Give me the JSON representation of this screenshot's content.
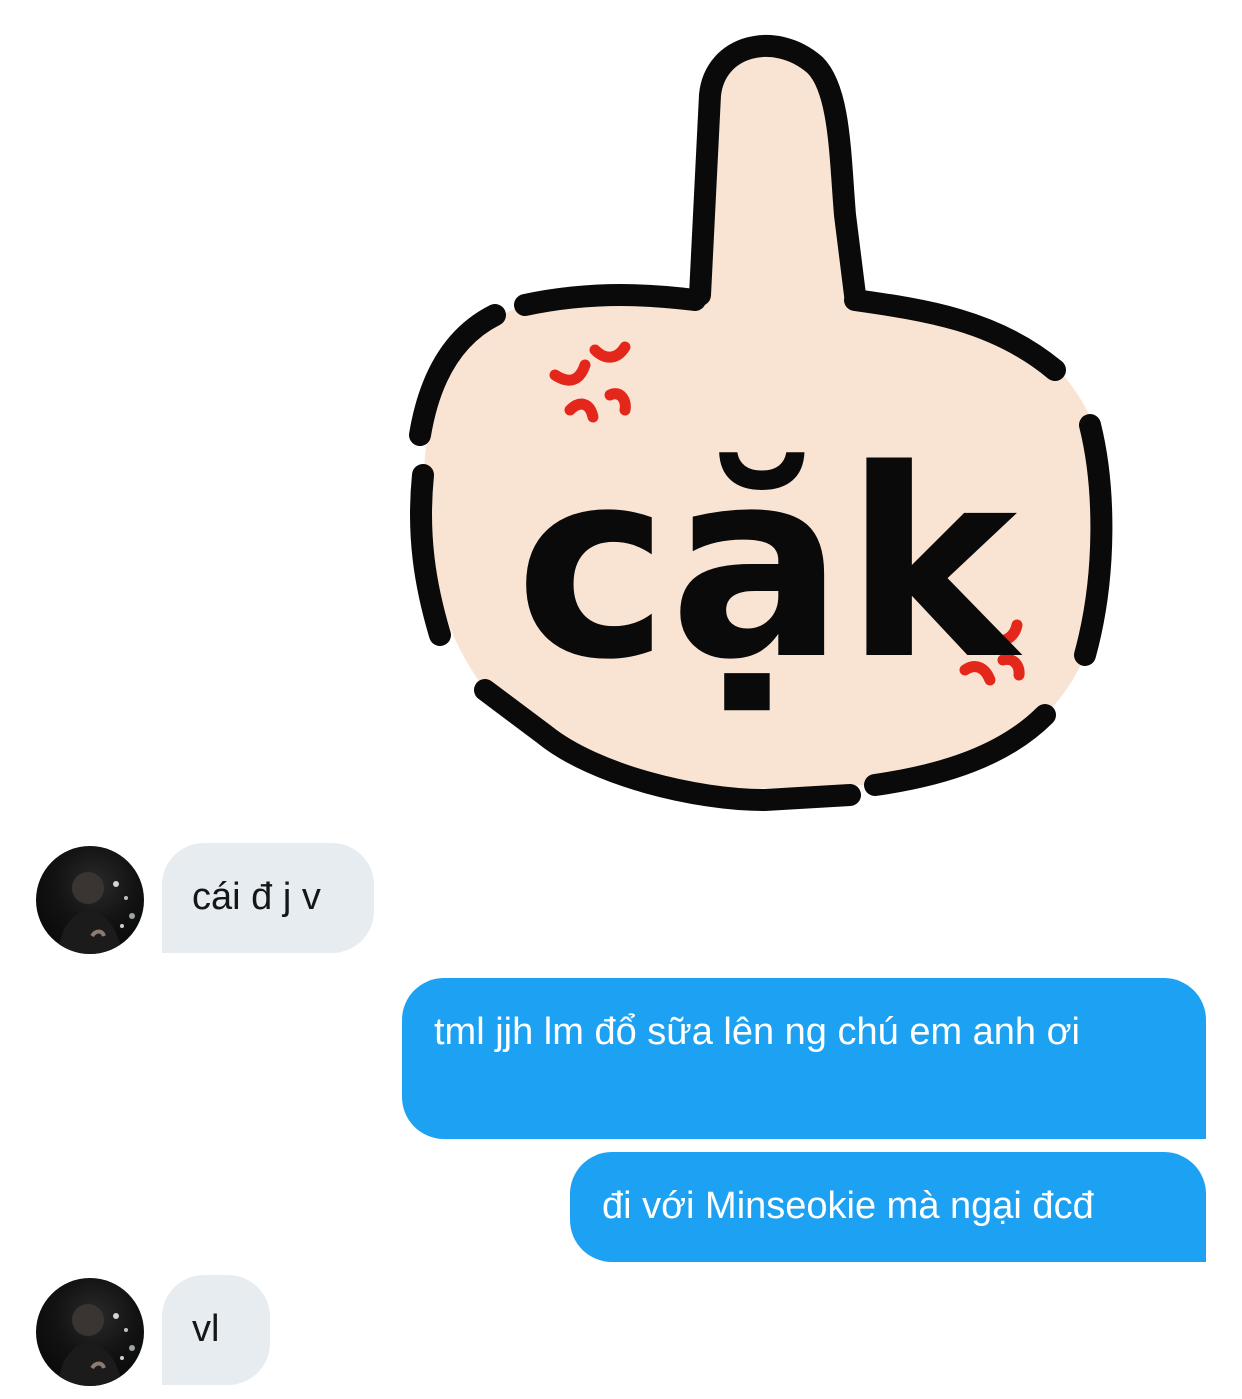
{
  "sticker": {
    "text": "cặk",
    "icon": "middle-finger-sticker",
    "colors": {
      "skin": "#f9e4d4",
      "outline": "#0a0a0a",
      "anger_marks": "#e3271b"
    }
  },
  "messages": [
    {
      "direction": "incoming",
      "text": "cái đ j v",
      "avatar": true
    },
    {
      "direction": "outgoing",
      "text": "tml jjh lm đổ sữa lên ng chú em anh ơi"
    },
    {
      "direction": "outgoing",
      "text": "đi với Minseokie mà ngại đcđ"
    },
    {
      "direction": "incoming",
      "text": "vl",
      "avatar": true
    }
  ],
  "colors": {
    "incoming_bubble": "#e6ecf0",
    "incoming_text": "#14171a",
    "outgoing_bubble": "#1da1f2",
    "outgoing_text": "#ffffff",
    "background": "#ffffff"
  }
}
